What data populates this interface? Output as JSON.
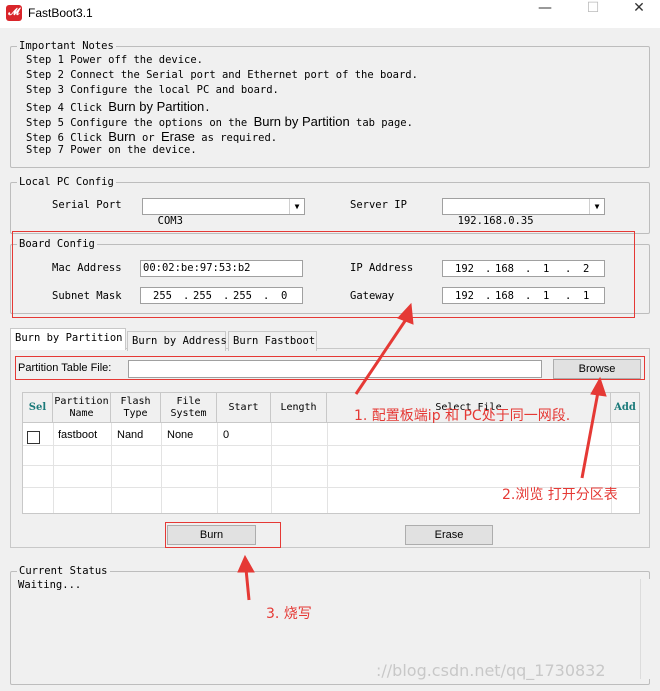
{
  "window": {
    "title": "FastBoot3.1",
    "minimize": "—",
    "maximize": "☐",
    "close": "✕"
  },
  "notes": {
    "title": "Important Notes",
    "steps": [
      {
        "pre": "Step 1 Power off the device.",
        "bold": "",
        "post": ""
      },
      {
        "pre": "Step 2 Connect the Serial port and Ethernet port of the board.",
        "bold": "",
        "post": ""
      },
      {
        "pre": "Step 3 Configure the local PC and board.",
        "bold": "",
        "post": ""
      },
      {
        "pre": "Step 4 Click ",
        "bold": "Burn by Partition",
        "post": "."
      },
      {
        "pre": "Step 5 Configure the options on the ",
        "bold": "Burn by Partition",
        "post": " tab page."
      },
      {
        "pre": "Step 6 Click ",
        "bold": "Burn",
        "post": " or ",
        "bold2": "Erase",
        "post2": " as required."
      },
      {
        "pre": "Step 7 Power on the device.",
        "bold": "",
        "post": ""
      }
    ]
  },
  "pc_config": {
    "title": "Local PC Config",
    "serial_label": "Serial Port",
    "serial_value": "COM3",
    "server_label": "Server IP",
    "server_value": "192.168.0.35"
  },
  "board_config": {
    "title": "Board Config",
    "mac_label": "Mac Address",
    "mac_value": "00:02:be:97:53:b2",
    "ip_label": "IP Address",
    "ip": [
      "192",
      "168",
      "1",
      "2"
    ],
    "subnet_label": "Subnet Mask",
    "subnet": [
      "255",
      "255",
      "255",
      "0"
    ],
    "gateway_label": "Gateway",
    "gateway": [
      "192",
      "168",
      "1",
      "1"
    ]
  },
  "tabs": [
    "Burn by Partition",
    "Burn by Address",
    "Burn Fastboot"
  ],
  "partition": {
    "file_label": "Partition Table File:",
    "file_value": "",
    "browse": "Browse"
  },
  "table": {
    "columns": [
      "Sel",
      "Partition\nName",
      "Flash\nType",
      "File\nSystem",
      "Start",
      "Length",
      "Select File",
      "Add"
    ],
    "rows": [
      {
        "name": "fastboot",
        "type": "Nand",
        "fs": "None",
        "start": "0",
        "length": "",
        "file": ""
      }
    ]
  },
  "actions": {
    "burn": "Burn",
    "erase": "Erase"
  },
  "status": {
    "title": "Current Status",
    "text": "Waiting..."
  },
  "annotations": {
    "a1": "1. 配置板端ip 和 PC处于同一网段.",
    "a2": "2.浏览 打开分区表",
    "a3": "3. 烧写"
  },
  "watermark": "://blog.csdn.net/qq_1730832",
  "colors": {
    "annotation_red": "#e53935"
  }
}
